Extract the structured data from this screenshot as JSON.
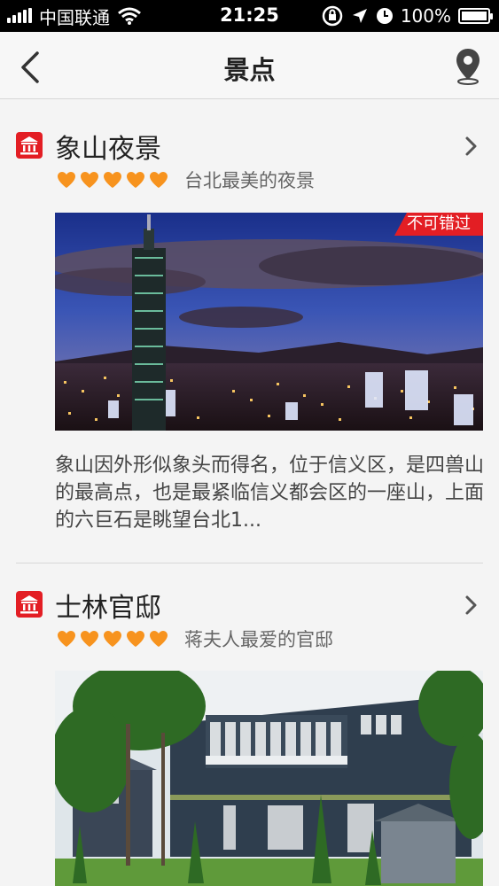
{
  "status_bar": {
    "carrier": "中国联通",
    "time": "21:25",
    "battery": "100%",
    "battery_level": 1.0
  },
  "nav": {
    "title": "景点",
    "back_icon": "chevron-left-icon",
    "map_icon": "map-pin-icon"
  },
  "accent_color": "#e31e24",
  "heart_color": "#f7931e",
  "attractions": [
    {
      "name": "象山夜景",
      "rating": 5,
      "tagline": "台北最美的夜景",
      "badge": "不可错过",
      "description": "象山因外形似象头而得名，位于信义区，是四兽山的最高点，也是最紧临信义都会区的一座山，上面的六巨石是眺望台北1..."
    },
    {
      "name": "士林官邸",
      "rating": 5,
      "tagline": "蒋夫人最爱的官邸"
    }
  ]
}
